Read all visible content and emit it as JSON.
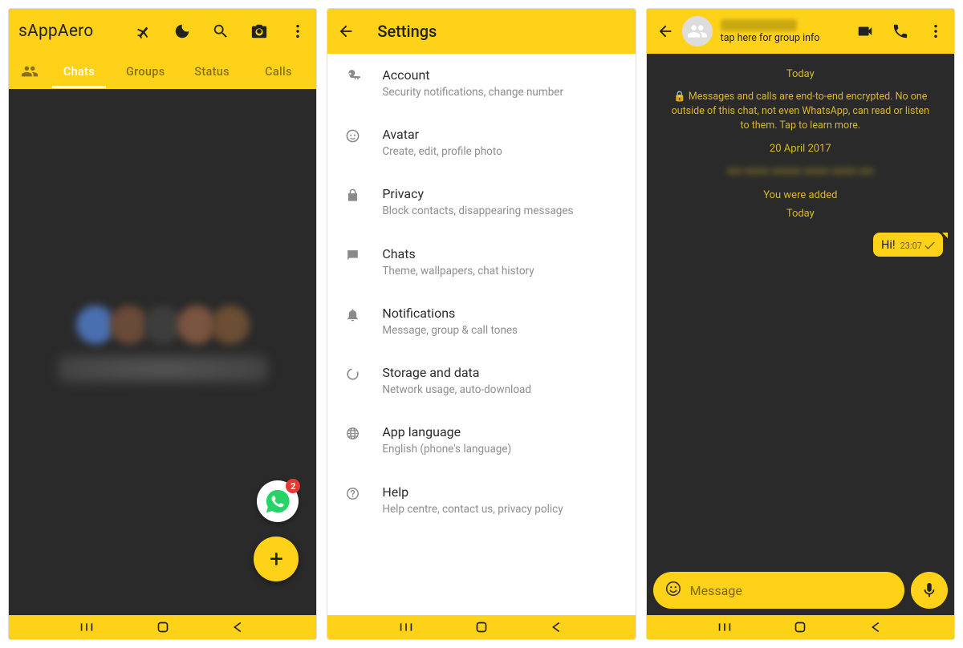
{
  "colors": {
    "accent": "#ffd21a",
    "dark": "#2a2a2a"
  },
  "screen1": {
    "app_title": "sAppAero",
    "tabs": [
      "Chats",
      "Groups",
      "Status",
      "Calls"
    ],
    "badge_count": "2"
  },
  "screen2": {
    "title": "Settings",
    "items": [
      {
        "t": "Account",
        "s": "Security notifications, change number"
      },
      {
        "t": "Avatar",
        "s": "Create, edit, profile photo"
      },
      {
        "t": "Privacy",
        "s": "Block contacts, disappearing messages"
      },
      {
        "t": "Chats",
        "s": "Theme, wallpapers, chat history"
      },
      {
        "t": "Notifications",
        "s": "Message, group & call tones"
      },
      {
        "t": "Storage and data",
        "s": "Network usage, auto-download"
      },
      {
        "t": "App language",
        "s": "English (phone's language)"
      },
      {
        "t": "Help",
        "s": "Help centre, contact us, privacy policy"
      }
    ]
  },
  "screen3": {
    "subtitle": "tap here for group info",
    "day1": "Today",
    "enc": "🔒 Messages and calls are end-to-end encrypted. No one outside of this chat, not even WhatsApp, can read or listen to them. Tap to learn more.",
    "date1": "20 April 2017",
    "added": "You were added",
    "day2": "Today",
    "msg": {
      "text": "Hi!",
      "time": "23:07"
    },
    "placeholder": "Message"
  }
}
